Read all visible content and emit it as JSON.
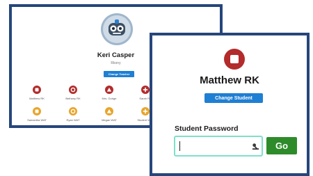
{
  "teacher": {
    "name": "Keri Casper",
    "subtitle": "Rkony",
    "change_button": "Change Teacher"
  },
  "students": [
    {
      "label": "Matthew RK",
      "color": "#b32b2b",
      "icon": "square-icon"
    },
    {
      "label": "Bethany RK",
      "color": "#b32b2b",
      "icon": "circle-icon"
    },
    {
      "label": "Mrs. Gorige",
      "color": "#b32b2b",
      "icon": "triangle-icon"
    },
    {
      "label": "Sarah RK",
      "color": "#b32b2b",
      "icon": "plus-icon"
    },
    {
      "label": "Samantha WAT",
      "color": "#e8a52a",
      "icon": "square-icon"
    },
    {
      "label": "Ryan WAT",
      "color": "#e8a52a",
      "icon": "circle-icon"
    },
    {
      "label": "Megan WAT",
      "color": "#e8a52a",
      "icon": "triangle-icon"
    },
    {
      "label": "Student WAT",
      "color": "#e8a52a",
      "icon": "plus-icon"
    }
  ],
  "login": {
    "student_name": "Matthew RK",
    "change_button": "Change Student",
    "password_label": "Student Password",
    "password_value": "",
    "go_button": "Go"
  },
  "colors": {
    "frame": "#26467b",
    "accent_blue": "#1f7fd3",
    "go_green": "#2e8b2a",
    "input_border": "#7fe0c9",
    "student_red": "#b32b2b",
    "student_orange": "#e8a52a"
  }
}
